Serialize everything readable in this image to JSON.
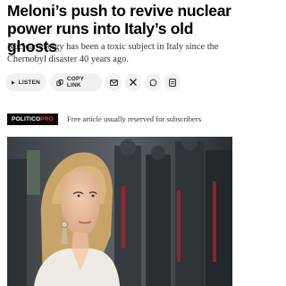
{
  "article": {
    "headline": "Meloni’s push to revive nuclear power runs into Italy’s old ghosts",
    "subhead": "Nuclear energy has been a toxic subject in Italy since the Chernobyl disaster 40 years ago."
  },
  "actions": {
    "listen_label": "LISTEN",
    "copy_link_label": "COPY LINK",
    "share_icons": [
      "email-icon",
      "x-icon",
      "whatsapp-icon",
      "save-icon"
    ]
  },
  "promo": {
    "badge_brand": "POLITICO",
    "badge_suffix": "PRO",
    "text": "Free article usually reserved for subscribers"
  },
  "colors": {
    "pro_accent": "#e8354b",
    "pill_bg": "#f1f1f1"
  }
}
